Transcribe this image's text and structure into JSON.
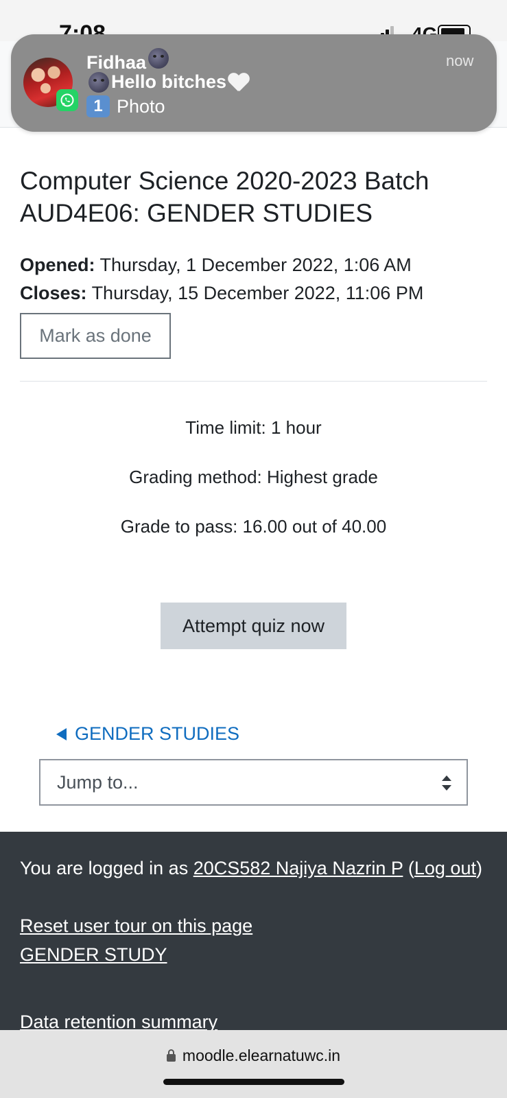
{
  "status_bar": {
    "time": "7:08",
    "network": "4G"
  },
  "notification": {
    "sender": "Fidhaa",
    "time": "now",
    "message": "Hello bitches",
    "attachment_count": "1",
    "attachment_label": "Photo",
    "app_icon": "whatsapp-icon"
  },
  "course": {
    "title": "Computer Science 2020-2023 Batch AUD4E06: GENDER STUDIES",
    "opened_label": "Opened:",
    "opened_value": "Thursday, 1 December 2022, 1:06 AM",
    "closes_label": "Closes:",
    "closes_value": "Thursday, 15 December 2022, 11:06 PM",
    "mark_done_label": "Mark as done"
  },
  "quiz_info": {
    "time_limit": "Time limit: 1 hour",
    "grading_method": "Grading method: Highest grade",
    "grade_to_pass": "Grade to pass: 16.00 out of 40.00",
    "attempt_label": "Attempt quiz now"
  },
  "navigation": {
    "previous_link": "GENDER STUDIES",
    "jump_to_label": "Jump to..."
  },
  "footer": {
    "logged_in_prefix": "You are logged in as ",
    "user_name": "20CS582 Najiya Nazrin P",
    "open_paren": " (",
    "logout_label": "Log out",
    "close_paren": ")",
    "reset_tour": "Reset user tour on this page",
    "course_link": "GENDER STUDY",
    "data_retention": "Data retention summary"
  },
  "browser": {
    "url": "moodle.elearnatuwc.in"
  }
}
